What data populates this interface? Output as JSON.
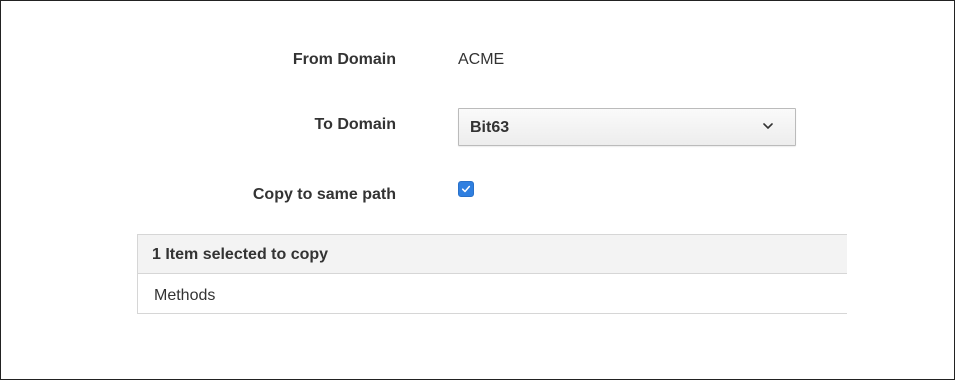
{
  "form": {
    "from_domain": {
      "label": "From Domain",
      "value": "ACME"
    },
    "to_domain": {
      "label": "To Domain",
      "selected": "Bit63",
      "caret_icon": "chevron-down-icon"
    },
    "copy_same_path": {
      "label": "Copy to same path",
      "checked": true,
      "check_color": "#2f7fe0"
    }
  },
  "items_panel": {
    "header": "1 Item selected to copy",
    "items": [
      {
        "label": "Methods"
      }
    ]
  }
}
